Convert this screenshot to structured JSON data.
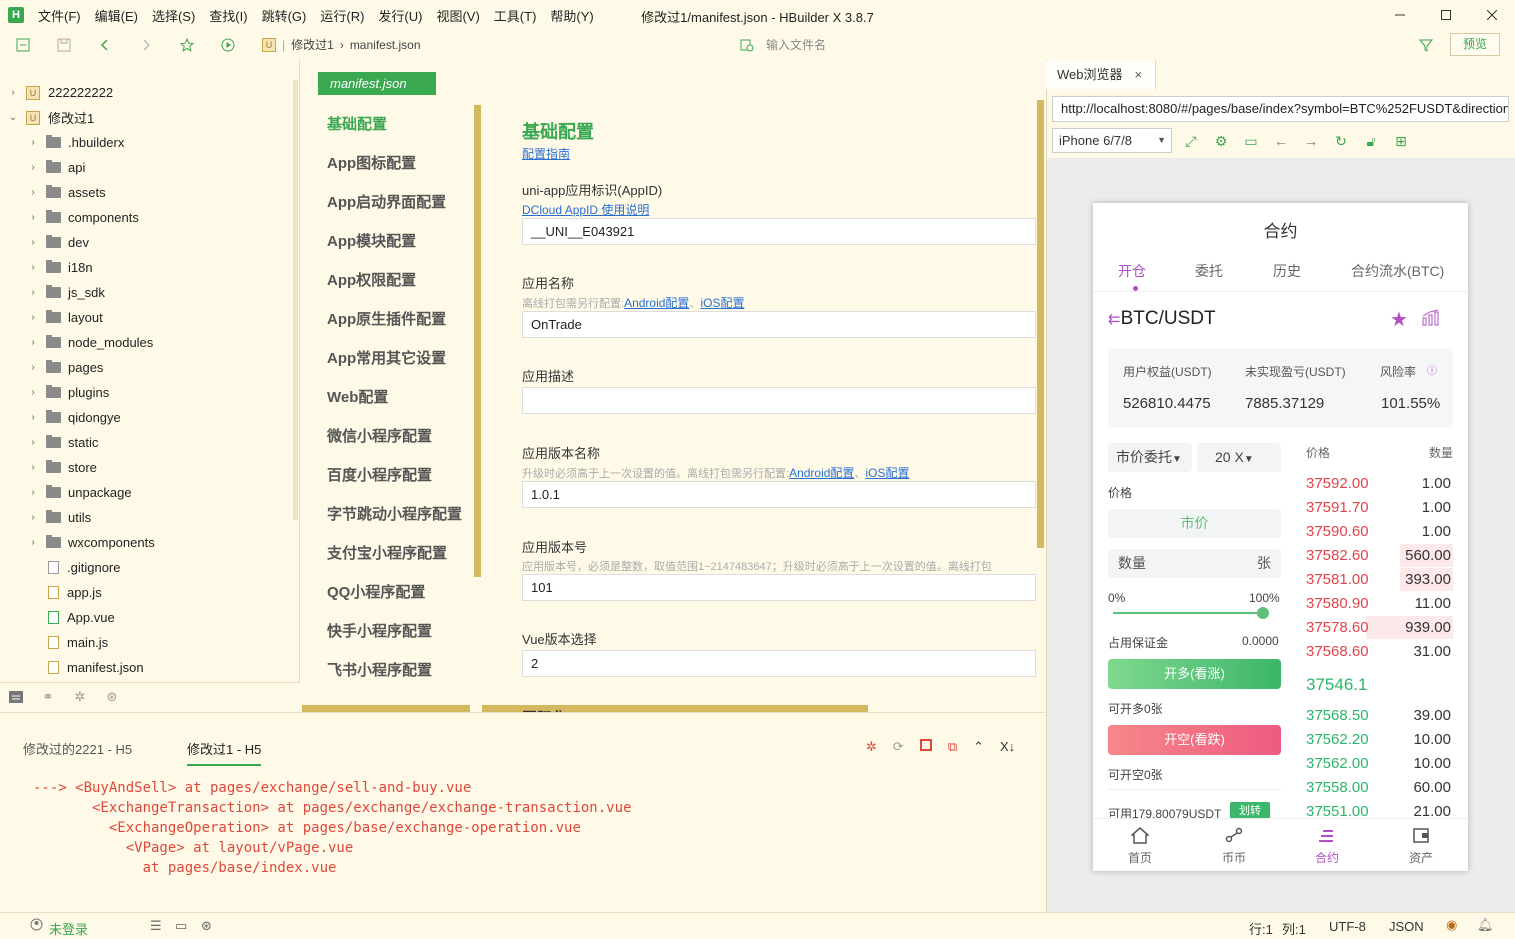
{
  "app": {
    "logo_text": "H",
    "window_title": "修改过1/manifest.json - HBuilder X 3.8.7",
    "menu": [
      "文件(F)",
      "编辑(E)",
      "选择(S)",
      "查找(I)",
      "跳转(G)",
      "运行(R)",
      "发行(U)",
      "视图(V)",
      "工具(T)",
      "帮助(Y)"
    ]
  },
  "toolbar": {
    "breadcrumb": [
      "修改过1",
      "manifest.json"
    ],
    "file_search_placeholder": "输入文件名",
    "preview_label": "预览"
  },
  "file_tree": {
    "projects": [
      {
        "name": "222222222",
        "expanded": false
      },
      {
        "name": "修改过1",
        "expanded": true
      }
    ],
    "folders": [
      "hbuilderx_dot",
      "api",
      "assets",
      "components",
      "dev",
      "i18n",
      "js_sdk",
      "layout",
      "node_modules",
      "pages",
      "plugins",
      "qidongye",
      "static",
      "store",
      "unpackage",
      "utils",
      "wxcomponents"
    ],
    "folder_labels": [
      ".hbuilderx",
      "api",
      "assets",
      "components",
      "dev",
      "i18n",
      "js_sdk",
      "layout",
      "node_modules",
      "pages",
      "plugins",
      "qidongye",
      "static",
      "store",
      "unpackage",
      "utils",
      "wxcomponents"
    ],
    "files": [
      ".gitignore",
      "app.js",
      "App.vue",
      "main.js",
      "manifest.json"
    ]
  },
  "editor": {
    "file_tab": "manifest.json",
    "nav": [
      "基础配置",
      "App图标配置",
      "App启动界面配置",
      "App模块配置",
      "App权限配置",
      "App原生插件配置",
      "App常用其它设置",
      "Web配置",
      "微信小程序配置",
      "百度小程序配置",
      "字节跳动小程序配置",
      "支付宝小程序配置",
      "QQ小程序配置",
      "快手小程序配置",
      "飞书小程序配置"
    ],
    "active_nav_index": 0,
    "form": {
      "title": "基础配置",
      "guide_link": "配置指南",
      "appid_label": "uni-app应用标识(AppID)",
      "appid_link": "DCloud AppID 使用说明",
      "appid_value": "__UNI__E043921",
      "name_label": "应用名称",
      "name_hint": "离线打包需另行配置:",
      "android_link": "Android配置",
      "ios_link": "iOS配置",
      "name_value": "OnTrade",
      "desc_label": "应用描述",
      "desc_value": "",
      "version_name_label": "应用版本名称",
      "version_name_hint": "升级时必须高于上一次设置的值。离线打包需另行配置:",
      "version_name_value": "1.0.1",
      "version_code_label": "应用版本号",
      "version_code_hint": "应用版本号，必须是整数，取值范围1~2147483647；升级时必须高于上一次设置的值。离线打包",
      "version_code_value": "101",
      "vue_label": "Vue版本选择",
      "vue_value": "2",
      "i18n_label": "国际化"
    }
  },
  "console": {
    "tabs": [
      "修改过的2221 - H5",
      "修改过1 - H5"
    ],
    "active_tab": 1,
    "lines": [
      "---> <BuyAndSell> at pages/exchange/sell-and-buy.vue",
      "       <ExchangeTransaction> at pages/exchange/exchange-transaction.vue",
      "         <ExchangeOperation> at pages/base/exchange-operation.vue",
      "           <VPage> at layout/vPage.vue",
      "             at pages/base/index.vue"
    ]
  },
  "browser": {
    "tab_label": "Web浏览器",
    "url": "http://localhost:8080/#/pages/base/index?symbol=BTC%252FUSDT&direction",
    "device": "iPhone 6/7/8"
  },
  "phone": {
    "title": "合约",
    "tabs": [
      "开仓",
      "委托",
      "历史",
      "合约流水(BTC)"
    ],
    "active_tab": 0,
    "pair": "BTC/USDT",
    "stats": [
      {
        "label": "用户权益(USDT)",
        "value": "526810.4475"
      },
      {
        "label": "未实现盈亏(USDT)",
        "value": "7885.37129"
      },
      {
        "label": "风险率",
        "value": "101.55%"
      }
    ],
    "order_type": "市价委托",
    "leverage": "20 X",
    "price_label": "价格",
    "market_label": "市价",
    "qty_placeholder": "数量",
    "qty_unit": "张",
    "slider_min": "0%",
    "slider_max": "100%",
    "slider_value": 1.0,
    "margin_label": "占用保证金",
    "margin_value": "0.0000",
    "open_long": "开多(看涨)",
    "can_open_long": "可开多0张",
    "open_short": "开空(看跌)",
    "can_open_short": "可开空0张",
    "available": "可用179.80079USDT",
    "transfer": "划转",
    "ob_price_header": "价格",
    "ob_qty_header": "数量",
    "asks": [
      {
        "price": "37592.00",
        "qty": "1.00",
        "depth": 0.0
      },
      {
        "price": "37591.70",
        "qty": "1.00",
        "depth": 0.0
      },
      {
        "price": "37590.60",
        "qty": "1.00",
        "depth": 0.0
      },
      {
        "price": "37582.60",
        "qty": "560.00",
        "depth": 0.35
      },
      {
        "price": "37581.00",
        "qty": "393.00",
        "depth": 0.35
      },
      {
        "price": "37580.90",
        "qty": "11.00",
        "depth": 0.0
      },
      {
        "price": "37578.60",
        "qty": "939.00",
        "depth": 0.58
      },
      {
        "price": "37568.60",
        "qty": "31.00",
        "depth": 0.0
      }
    ],
    "last_price": "37546.1",
    "bids": [
      {
        "price": "37568.50",
        "qty": "39.00"
      },
      {
        "price": "37562.20",
        "qty": "10.00"
      },
      {
        "price": "37562.00",
        "qty": "10.00"
      },
      {
        "price": "37558.00",
        "qty": "60.00"
      },
      {
        "price": "37551.00",
        "qty": "21.00"
      }
    ],
    "bottom_nav": [
      "首页",
      "币币",
      "合约",
      "资产"
    ],
    "active_nav": 2
  },
  "statusbar": {
    "login": "未登录",
    "line": "行:1",
    "col": "列:1",
    "encoding": "UTF-8",
    "syntax": "JSON"
  },
  "colors": {
    "accent": "#3aa751",
    "ask": "#e2444b",
    "bid": "#2cb46a",
    "phone_accent": "#b24fc6",
    "editor_bg": "#fffae8"
  }
}
